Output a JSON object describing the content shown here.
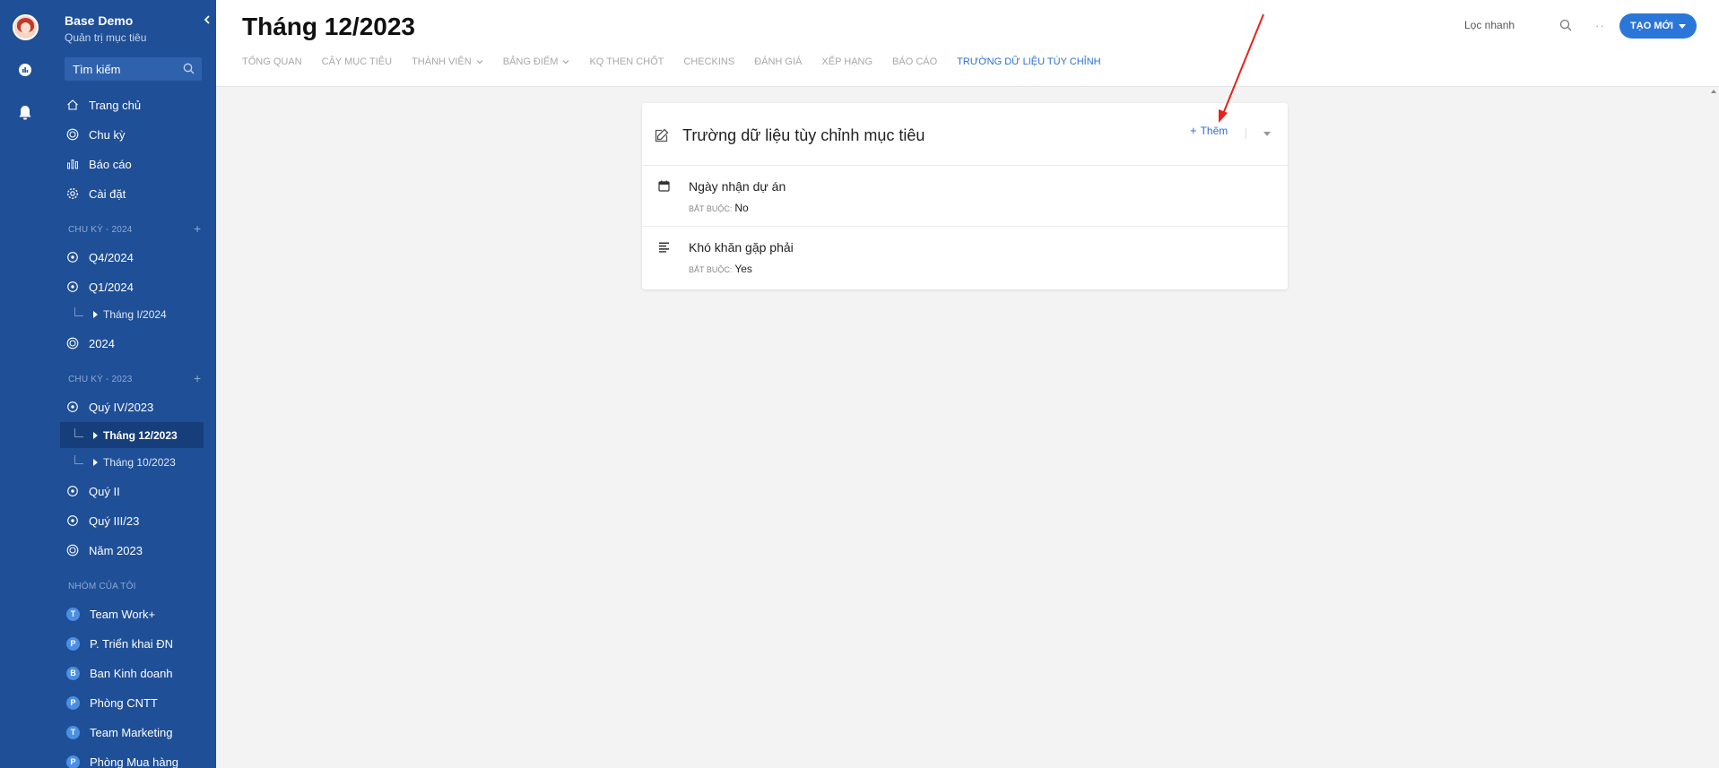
{
  "app": {
    "brand_title": "Base Demo",
    "brand_subtitle": "Quản trị mục tiêu"
  },
  "sidebar": {
    "search_placeholder": "Tìm kiếm",
    "main_nav": [
      {
        "label": "Trang chủ",
        "icon": "home-icon"
      },
      {
        "label": "Chu kỳ",
        "icon": "target-icon"
      },
      {
        "label": "Báo cáo",
        "icon": "bar-chart-icon"
      },
      {
        "label": "Cài đặt",
        "icon": "gear-icon"
      }
    ],
    "section_2024": {
      "label": "CHU KỲ - 2024",
      "items": [
        "Q4/2024",
        "Q1/2024",
        "Tháng I/2024",
        "2024"
      ]
    },
    "section_2023": {
      "label": "CHU KỲ - 2023",
      "items": [
        "Quý IV/2023",
        "Tháng 12/2023",
        "Tháng 10/2023",
        "Quý II",
        "Quý III/23",
        "Năm 2023"
      ]
    },
    "groups": {
      "label": "NHÓM CỦA TÔI",
      "items": [
        {
          "letter": "T",
          "label": "Team Work+"
        },
        {
          "letter": "P",
          "label": "P. Triển khai ĐN"
        },
        {
          "letter": "B",
          "label": "Ban Kinh doanh"
        },
        {
          "letter": "P",
          "label": "Phòng CNTT"
        },
        {
          "letter": "T",
          "label": "Team Marketing"
        },
        {
          "letter": "P",
          "label": "Phòng Mua hàng"
        }
      ]
    }
  },
  "header": {
    "title": "Tháng 12/2023",
    "tabs": [
      "TỔNG QUAN",
      "CÂY MỤC TIÊU",
      "THÀNH VIÊN",
      "BẢNG ĐIỂM",
      "KQ THEN CHỐT",
      "CHECKINS",
      "ĐÁNH GIÁ",
      "XẾP HẠNG",
      "BÁO CÁO",
      "TRƯỜNG DỮ LIỆU TÙY CHỈNH"
    ],
    "quick_filter": "Lọc nhanh",
    "more": "··",
    "create_label": "TẠO MỚI"
  },
  "card": {
    "title": "Trường dữ liệu tùy chỉnh mục tiêu",
    "add_label": "Thêm",
    "required_label": "BẮT BUỘC:",
    "fields": [
      {
        "name": "Ngày nhận dự án",
        "required": "No",
        "icon": "calendar-icon"
      },
      {
        "name": "Khó khăn gặp phải",
        "required": "Yes",
        "icon": "text-lines-icon"
      }
    ]
  },
  "colors": {
    "sidebar_bg": "#1f4f97",
    "active_item_bg": "#163e7a",
    "accent": "#2b76d9",
    "annotation_arrow": "#e8211b"
  }
}
